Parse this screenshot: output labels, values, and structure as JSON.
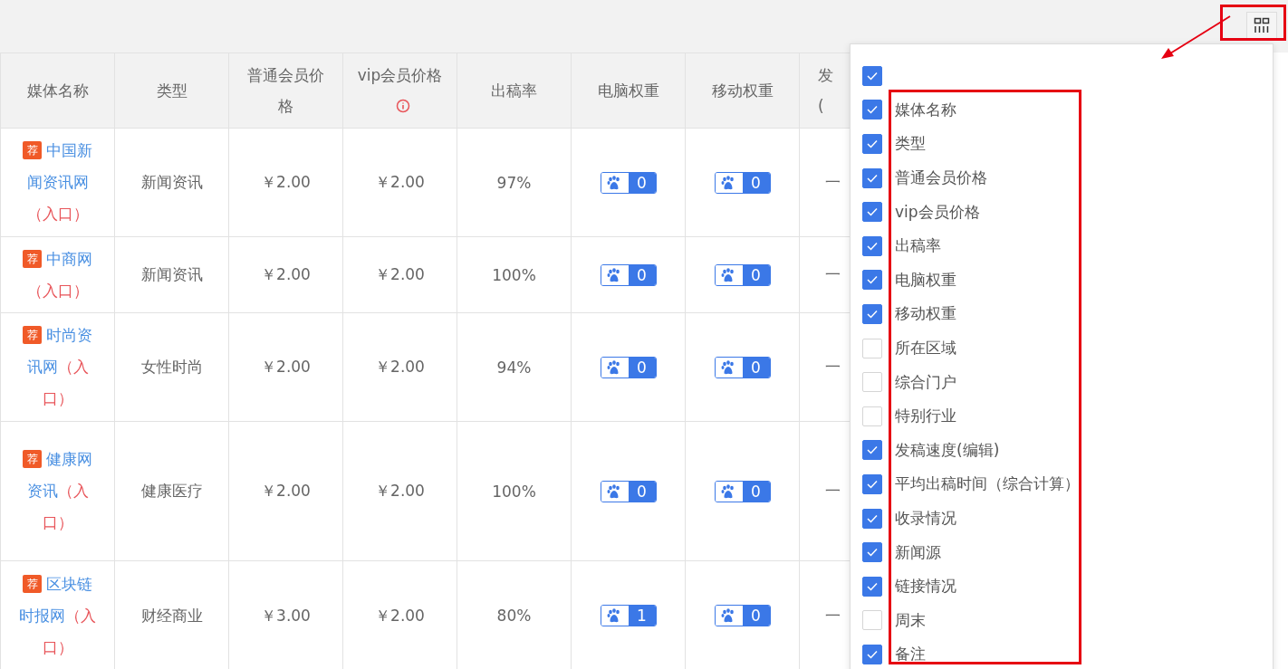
{
  "table": {
    "columns": [
      {
        "label": "媒体名称",
        "info": false
      },
      {
        "label": "类型",
        "info": false
      },
      {
        "label": "普通会员价格",
        "info": false
      },
      {
        "label": "vip会员价格",
        "info": true
      },
      {
        "label": "出稿率",
        "info": false
      },
      {
        "label": "电脑权重",
        "info": false
      },
      {
        "label": "移动权重",
        "info": false
      },
      {
        "label": "发(",
        "info": false
      }
    ],
    "rows": [
      {
        "tag": "荐",
        "name": "中国新闻资讯网",
        "entry": "（入口）",
        "type": "新闻资讯",
        "price": "￥2.00",
        "vip_price": "￥2.00",
        "rate": "97%",
        "pc_weight": "0",
        "mobile_weight": "0",
        "column_8": "一"
      },
      {
        "tag": "荐",
        "name": "中商网",
        "entry": "（入口）",
        "type": "新闻资讯",
        "price": "￥2.00",
        "vip_price": "￥2.00",
        "rate": "100%",
        "pc_weight": "0",
        "mobile_weight": "0",
        "column_8": "一"
      },
      {
        "tag": "荐",
        "name": "时尚资讯网",
        "entry": "（入口）",
        "type": "女性时尚",
        "price": "￥2.00",
        "vip_price": "￥2.00",
        "rate": "94%",
        "pc_weight": "0",
        "mobile_weight": "0",
        "column_8": "一"
      },
      {
        "tag": "荐",
        "name": "健康网资讯",
        "entry": "（入口）",
        "type": "健康医疗",
        "price": "￥2.00",
        "vip_price": "￥2.00",
        "rate": "100%",
        "pc_weight": "0",
        "mobile_weight": "0",
        "column_8": "一"
      },
      {
        "tag": "荐",
        "name": "区块链时报网",
        "entry": "（入口）",
        "type": "财经商业",
        "price": "￥3.00",
        "vip_price": "￥2.00",
        "rate": "80%",
        "pc_weight": "1",
        "mobile_weight": "0",
        "column_8": "一"
      }
    ]
  },
  "column_menu": {
    "items": [
      {
        "checked": true
      },
      {
        "label": "媒体名称",
        "checked": true
      },
      {
        "label": "类型",
        "checked": true
      },
      {
        "label": "普通会员价格",
        "checked": true
      },
      {
        "label": "vip会员价格",
        "checked": true
      },
      {
        "label": "出稿率",
        "checked": true
      },
      {
        "label": "电脑权重",
        "checked": true
      },
      {
        "label": "移动权重",
        "checked": true
      },
      {
        "label": "所在区域",
        "checked": false
      },
      {
        "label": "综合门户",
        "checked": false
      },
      {
        "label": "特别行业",
        "checked": false
      },
      {
        "label": "发稿速度(编辑)",
        "checked": true
      },
      {
        "label": "平均出稿时间（综合计算）",
        "checked": true
      },
      {
        "label": "收录情况",
        "checked": true
      },
      {
        "label": "新闻源",
        "checked": true
      },
      {
        "label": "链接情况",
        "checked": true
      },
      {
        "label": "周末",
        "checked": false
      },
      {
        "label": "备注",
        "checked": true
      }
    ]
  }
}
